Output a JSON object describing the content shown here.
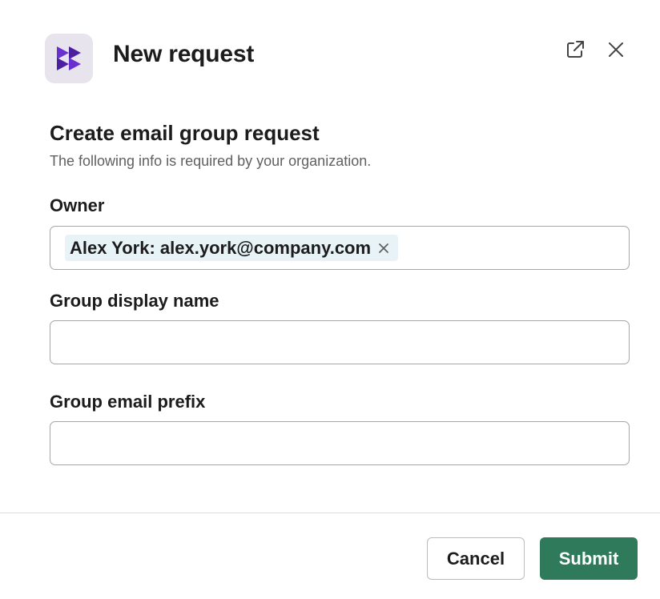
{
  "header": {
    "title": "New request",
    "app_icon": "double-chevron-right-icon",
    "brand_color": "#5b2bb3",
    "external_link_icon": "external-link-icon",
    "close_icon": "close-icon"
  },
  "form": {
    "section_title": "Create email group request",
    "section_subtitle": "The following info is required by your organization.",
    "fields": [
      {
        "label": "Owner",
        "chips": [
          {
            "label": "Alex York: alex.york@company.com"
          }
        ]
      },
      {
        "label": "Group display name",
        "value": "",
        "placeholder": ""
      },
      {
        "label": "Group email prefix",
        "value": "",
        "placeholder": ""
      }
    ]
  },
  "footer": {
    "cancel_label": "Cancel",
    "submit_label": "Submit",
    "submit_color": "#2f7a5a"
  }
}
